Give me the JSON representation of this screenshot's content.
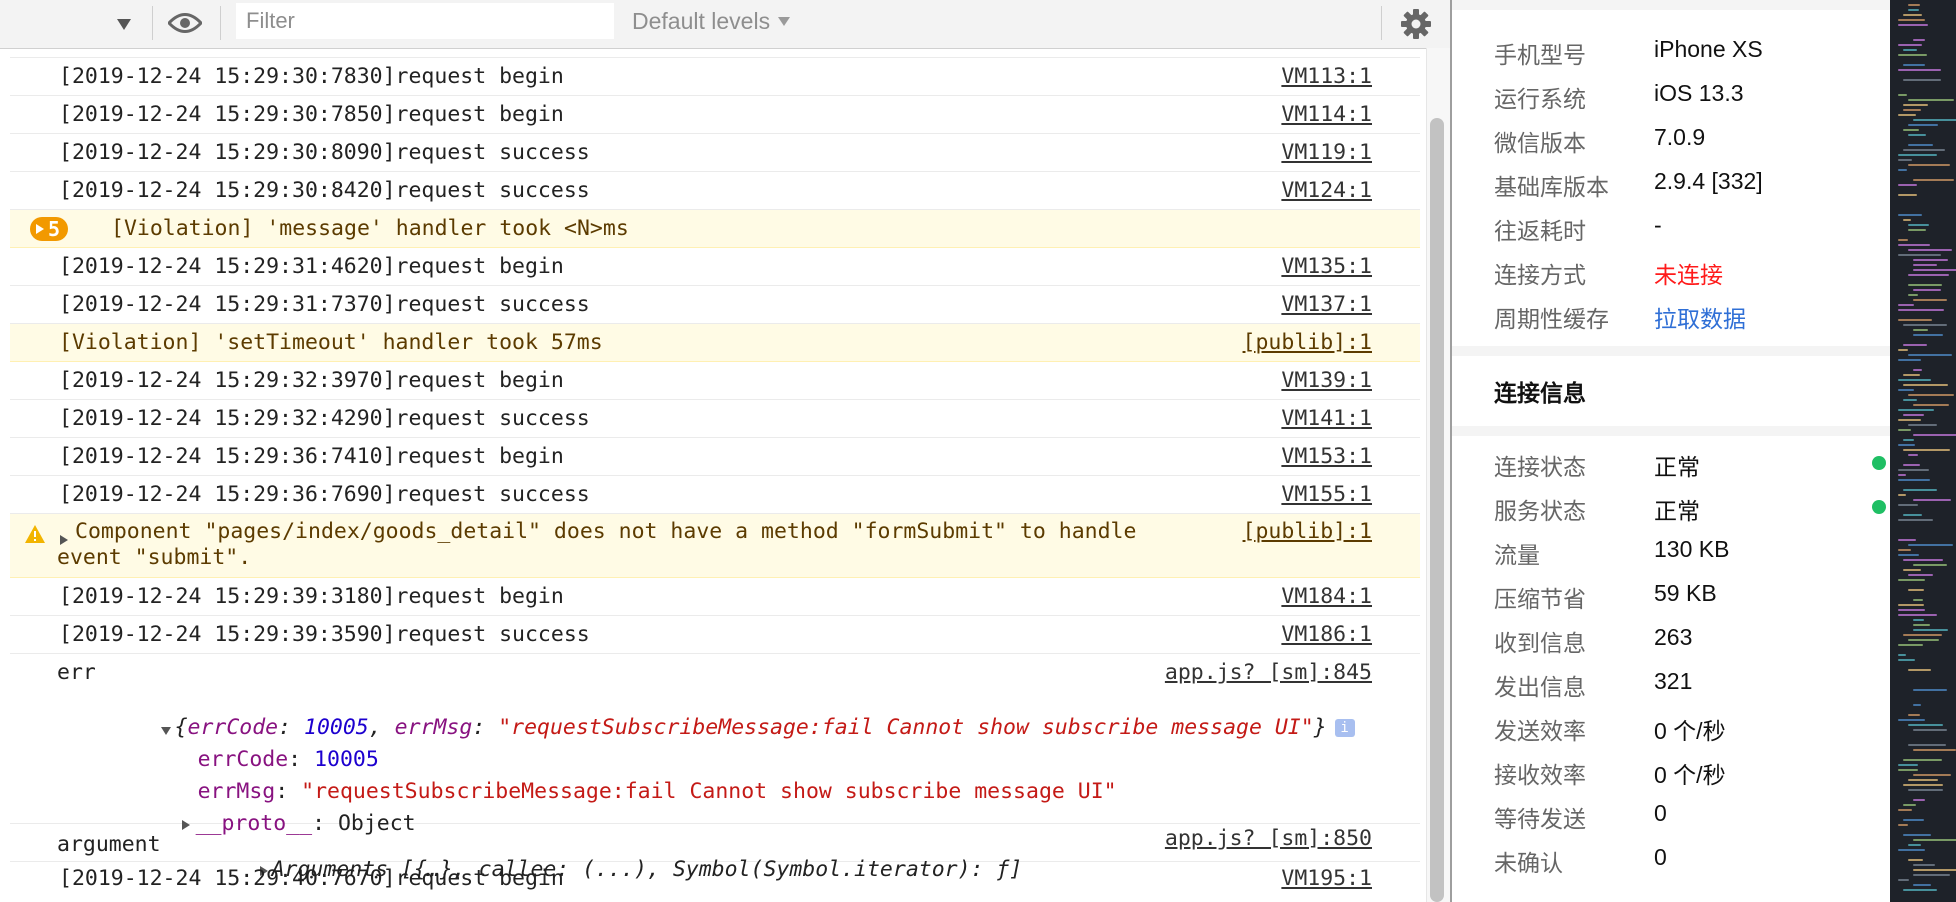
{
  "toolbar": {
    "filter_placeholder": "Filter",
    "levels_label": "Default levels",
    "icons": [
      "dropdown-arrow-icon",
      "eye-icon",
      "gear-icon"
    ]
  },
  "log": {
    "rows": [
      {
        "type": "log",
        "text": "[2019-12-24 15:29:30:7830]request begin",
        "source": "VM113:1"
      },
      {
        "type": "log",
        "text": "[2019-12-24 15:29:30:7850]request begin",
        "source": "VM114:1"
      },
      {
        "type": "log",
        "text": "[2019-12-24 15:29:30:8090]request success",
        "source": "VM119:1"
      },
      {
        "type": "log",
        "text": "[2019-12-24 15:29:30:8420]request success",
        "source": "VM124:1"
      },
      {
        "type": "violation-group",
        "count": "5",
        "text": "[Violation] 'message' handler took <N>ms",
        "source": ""
      },
      {
        "type": "log",
        "text": "[2019-12-24 15:29:31:4620]request begin",
        "source": "VM135:1"
      },
      {
        "type": "log",
        "text": "[2019-12-24 15:29:31:7370]request success",
        "source": "VM137:1"
      },
      {
        "type": "violation",
        "text": "[Violation] 'setTimeout' handler took 57ms",
        "source": "[publib]:1"
      },
      {
        "type": "log",
        "text": "[2019-12-24 15:29:32:3970]request begin",
        "source": "VM139:1"
      },
      {
        "type": "log",
        "text": "[2019-12-24 15:29:32:4290]request success",
        "source": "VM141:1"
      },
      {
        "type": "log",
        "text": "[2019-12-24 15:29:36:7410]request begin",
        "source": "VM153:1"
      },
      {
        "type": "log",
        "text": "[2019-12-24 15:29:36:7690]request success",
        "source": "VM155:1"
      },
      {
        "type": "warning",
        "text": "Component \"pages/index/goods_detail\" does not have a method \"formSubmit\" to handle",
        "text2": "event \"submit\".",
        "source": "[publib]:1"
      },
      {
        "type": "log",
        "text": "[2019-12-24 15:29:39:3180]request begin",
        "source": "VM184:1"
      },
      {
        "type": "log",
        "text": "[2019-12-24 15:29:39:3590]request success",
        "source": "VM186:1"
      }
    ],
    "err_block": {
      "label": "err",
      "source": "app.js? [sm]:845",
      "summary_open": "{",
      "summary_key1": "errCode",
      "summary_val1": "10005",
      "summary_key2": "errMsg",
      "summary_val2": "\"requestSubscribeMessage:fail Cannot show subscribe message UI\"",
      "summary_close": "}",
      "info_icon": "i",
      "prop1_key": "errCode",
      "prop1_val": "10005",
      "prop2_key": "errMsg",
      "prop2_val": "\"requestSubscribeMessage:fail Cannot show subscribe message UI\"",
      "proto_key": "__proto__",
      "proto_val": "Object"
    },
    "argument_block": {
      "label": "argument",
      "value": "Arguments [{…}, callee: (...), Symbol(Symbol.iterator): ƒ]",
      "source": "app.js? [sm]:850"
    },
    "last_row": {
      "text": "[2019-12-24 15:29:40:7670]request begin",
      "source": "VM195:1"
    }
  },
  "info_panel": {
    "device_rows": [
      {
        "label": "手机型号",
        "value": "iPhone XS",
        "style": "normal"
      },
      {
        "label": "运行系统",
        "value": "iOS 13.3",
        "style": "normal"
      },
      {
        "label": "微信版本",
        "value": "7.0.9",
        "style": "normal"
      },
      {
        "label": "基础库版本",
        "value": "2.9.4 [332]",
        "style": "normal"
      },
      {
        "label": "往返耗时",
        "value": "-",
        "style": "normal"
      },
      {
        "label": "连接方式",
        "value": "未连接",
        "style": "red"
      },
      {
        "label": "周期性缓存",
        "value": "拉取数据",
        "style": "blue"
      }
    ],
    "connection_title": "连接信息",
    "connection_rows": [
      {
        "label": "连接状态",
        "value": "正常",
        "dot": true
      },
      {
        "label": "服务状态",
        "value": "正常",
        "dot": true
      },
      {
        "label": "流量",
        "value": "130 KB"
      },
      {
        "label": "压缩节省",
        "value": "59 KB"
      },
      {
        "label": "收到信息",
        "value": "263"
      },
      {
        "label": "发出信息",
        "value": "321"
      },
      {
        "label": "发送效率",
        "value": "0 个/秒"
      },
      {
        "label": "接收效率",
        "value": "0 个/秒"
      },
      {
        "label": "等待发送",
        "value": "0"
      },
      {
        "label": "未确认",
        "value": "0"
      }
    ]
  },
  "colors": {
    "warning_bg": "#fffbe5",
    "badge": "#f29900",
    "status_ok": "#1fbf64",
    "disconnected": "#ff1a1a",
    "link": "#2f6fd6"
  }
}
